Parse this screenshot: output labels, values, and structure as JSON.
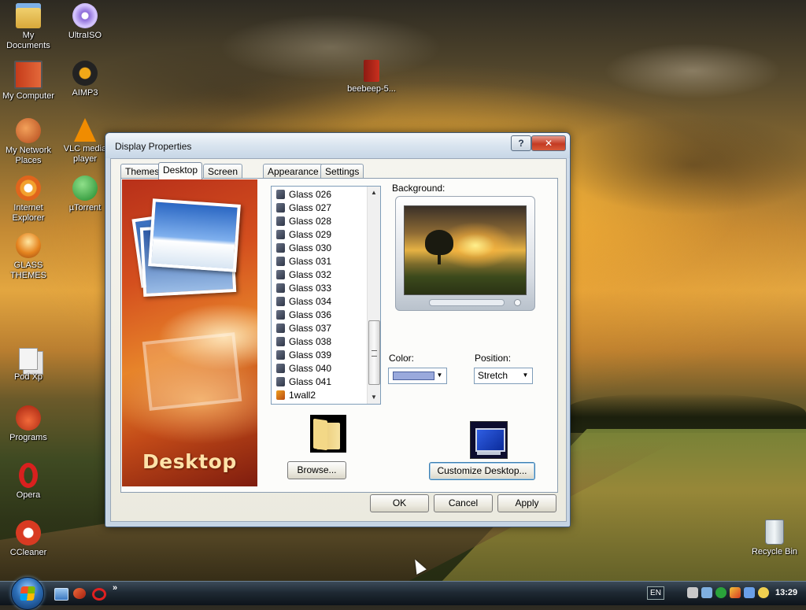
{
  "desktop": {
    "icons": [
      {
        "label": "My Documents",
        "icon": "folder-documents-icon"
      },
      {
        "label": "UltraISO",
        "icon": "disc-icon"
      },
      {
        "label": "My Computer",
        "icon": "computer-icon"
      },
      {
        "label": "AIMP3",
        "icon": "aimp-icon"
      },
      {
        "label": "My Network Places",
        "icon": "network-icon"
      },
      {
        "label": "VLC media player",
        "icon": "vlc-cone-icon"
      },
      {
        "label": "Internet Explorer",
        "icon": "ie-icon"
      },
      {
        "label": "µTorrent",
        "icon": "utorrent-icon"
      },
      {
        "label": "GLASS THEMES",
        "icon": "windows-orb-icon"
      },
      {
        "label": "Pod Xp",
        "icon": "documents-icon"
      },
      {
        "label": "Programs",
        "icon": "programs-icon"
      },
      {
        "label": "Opera",
        "icon": "opera-icon"
      },
      {
        "label": "CCleaner",
        "icon": "ccleaner-icon"
      },
      {
        "label": "beebeep-5...",
        "icon": "book-icon"
      },
      {
        "label": "Recycle Bin",
        "icon": "recycle-bin-icon"
      }
    ]
  },
  "window": {
    "title": "Display Properties",
    "help_label": "?",
    "close_label": "✕",
    "tabs": [
      {
        "label": "Themes"
      },
      {
        "label": "Desktop",
        "active": true
      },
      {
        "label": "Screen Saver"
      },
      {
        "label": "Appearance"
      },
      {
        "label": "Settings"
      }
    ],
    "banner_title": "Desktop",
    "background_label": "Background:",
    "backgrounds": [
      "Glass 026",
      "Glass 027",
      "Glass 028",
      "Glass 029",
      "Glass 030",
      "Glass 031",
      "Glass 032",
      "Glass 033",
      "Glass 034",
      "Glass 036",
      "Glass 037",
      "Glass 038",
      "Glass 039",
      "Glass 040",
      "Glass 041",
      "1wall2"
    ],
    "color_label": "Color:",
    "color_value": "#9aa9dc",
    "position_label": "Position:",
    "position_value": "Stretch",
    "browse_label": "Browse...",
    "customize_label": "Customize Desktop...",
    "ok_label": "OK",
    "cancel_label": "Cancel",
    "apply_label": "Apply"
  },
  "taskbar": {
    "language": "EN",
    "clock": "13:29",
    "overflow": "»"
  }
}
